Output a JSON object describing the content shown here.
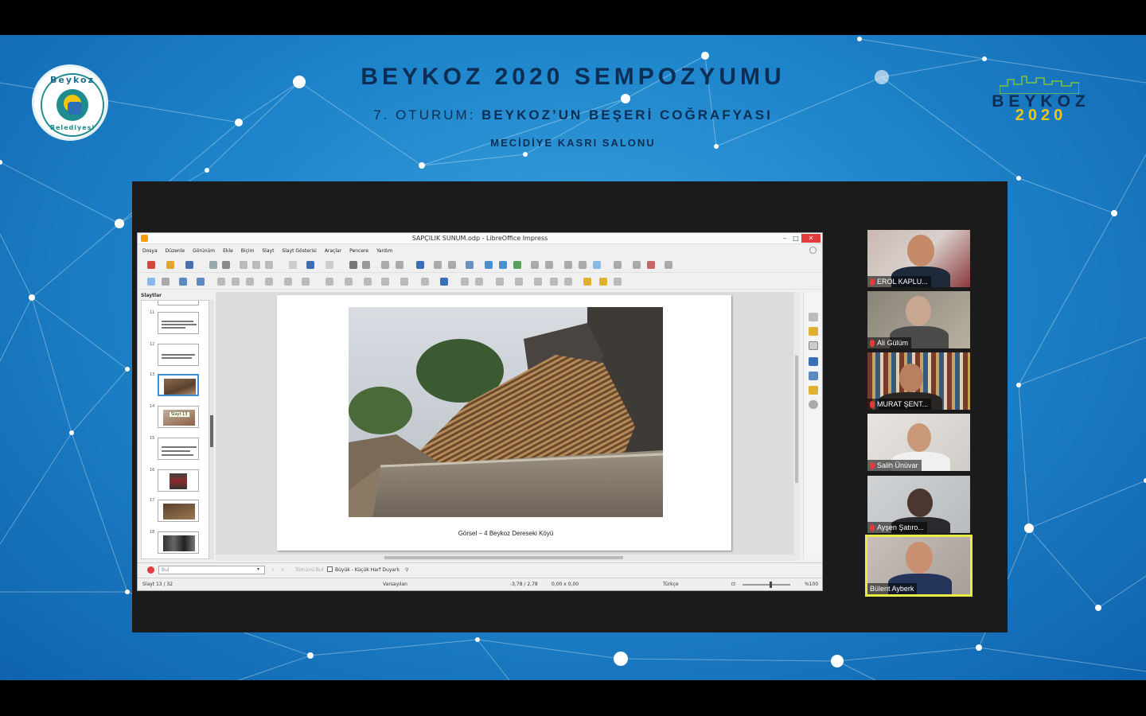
{
  "event": {
    "title": "BEYKOZ 2020 SEMPOZYUMU",
    "session_prefix": "7. OTURUM:",
    "session_name": "BEYKOZ’UN BEŞERİ COĞRAFYASI",
    "venue": "MECİDİYE KASRI SALONU"
  },
  "logos": {
    "left_top": "Beykoz",
    "left_bottom": "Belediyesi",
    "right_word": "BEYKOZ",
    "right_year": "2020"
  },
  "impress": {
    "window_title": "SAPÇILIK SUNUM.odp - LibreOffice Impress",
    "menu": [
      "Dosya",
      "Düzenle",
      "Görünüm",
      "Ekle",
      "Biçim",
      "Slayt",
      "Slayt Gösterisi",
      "Araçlar",
      "Pencere",
      "Yardım"
    ],
    "pane_title": "Slaytlar",
    "slide_numbers": [
      "11",
      "12",
      "13",
      "14",
      "15",
      "16",
      "17",
      "18"
    ],
    "tooltip": "Slayt 13",
    "caption": "Görsel – 4 Beykoz Dereseki Köyü",
    "find_placeholder": "Bul",
    "find_all": "Tümünü Bul",
    "match_case": "Büyük - Küçük Harf Duyarlı",
    "status": {
      "slide": "Slayt 13 / 32",
      "layout": "Varsayılan",
      "position": "-3,78 / 2,78",
      "size": "0,00 x 0,00",
      "language": "Türkçe",
      "zoom": "%100"
    }
  },
  "participants": [
    {
      "name": "EROL KAPLU...",
      "active": false
    },
    {
      "name": "Ali Gülüm",
      "active": false
    },
    {
      "name": "MURAT ŞENT...",
      "active": false
    },
    {
      "name": "Salih Ünüvar",
      "active": false
    },
    {
      "name": "Ayşen Şatıro...",
      "active": false
    },
    {
      "name": "Bülent Ayberk",
      "active": true
    }
  ],
  "colors": {
    "title_navy": "#0c2e55",
    "accent_yellow": "#f1c40f",
    "active_speaker": "#e8ec45",
    "mic_muted": "#e23b3b"
  }
}
